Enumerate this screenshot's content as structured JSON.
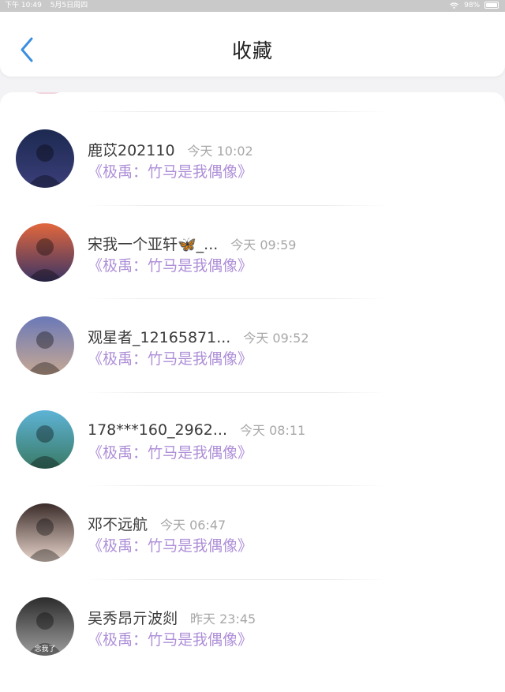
{
  "status_bar": {
    "time": "下午 10:49",
    "date": "5月5日周四",
    "battery": "98%",
    "battery_level": 0.98
  },
  "header": {
    "title": "收藏"
  },
  "items": [
    {
      "username": "鹿苡202110",
      "time": "今天 10:02",
      "book": "《极禹：竹马是我偶像》",
      "avatar_colors": [
        "#1c2950",
        "#3b3f7a"
      ]
    },
    {
      "username": "宋我一个亚轩🦋_...",
      "time": "今天 09:59",
      "book": "《极禹：竹马是我偶像》",
      "avatar_colors": [
        "#e2673c",
        "#3b3566"
      ]
    },
    {
      "username": "观星者_12165871...",
      "time": "今天 09:52",
      "book": "《极禹：竹马是我偶像》",
      "avatar_colors": [
        "#6a79b8",
        "#c7a893"
      ]
    },
    {
      "username": "178***160_2962...",
      "time": "今天 08:11",
      "book": "《极禹：竹马是我偶像》",
      "avatar_colors": [
        "#5eb3d6",
        "#3a7a66"
      ]
    },
    {
      "username": "邓不远航",
      "time": "今天 06:47",
      "book": "《极禹：竹马是我偶像》",
      "avatar_colors": [
        "#3b2c2a",
        "#e9d6cc"
      ]
    },
    {
      "username": "吴秀昂亓波剡",
      "time": "昨天 23:45",
      "book": "《极禹：竹马是我偶像》",
      "avatar_colors": [
        "#2c2c2c",
        "#9e9e9e"
      ],
      "avatar_text": "念我了"
    }
  ]
}
